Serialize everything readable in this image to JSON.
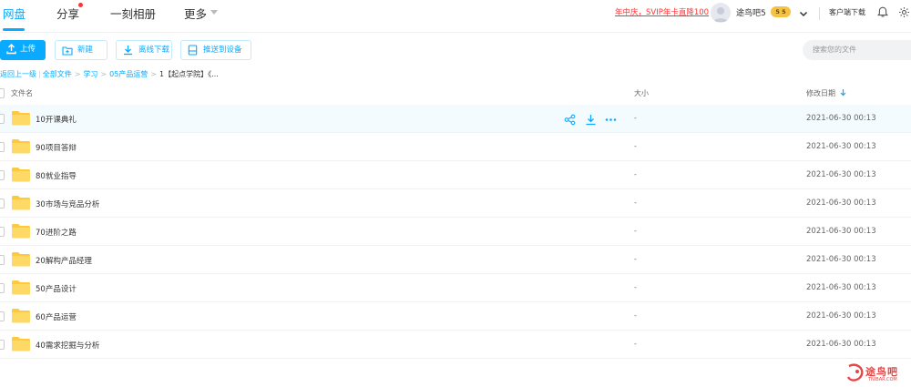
{
  "nav": {
    "tabs": [
      "网盘",
      "分享",
      "一刻相册",
      "更多"
    ],
    "active_tab": "网盘",
    "promo": "年中庆，SVIP年卡直降100",
    "username": "途鸟吧5",
    "vip_badge": "5 5",
    "client_download": "客户端下载"
  },
  "toolbar": {
    "upload": "上传",
    "new": "新建",
    "offline": "离线下载",
    "push": "推送到设备",
    "search_placeholder": "搜索您的文件"
  },
  "breadcrumb": {
    "back": "返回上一级",
    "all": "全部文件",
    "items": [
      "学习",
      "05产品运营"
    ],
    "current": "1【起点学院】《..."
  },
  "table": {
    "headers": {
      "name": "文件名",
      "size": "大小",
      "date": "修改日期"
    },
    "rows": [
      {
        "name": "10开课典礼",
        "size": "-",
        "date": "2021-06-30 00:13"
      },
      {
        "name": "90项目答辩",
        "size": "-",
        "date": "2021-06-30 00:13"
      },
      {
        "name": "80就业指导",
        "size": "-",
        "date": "2021-06-30 00:13"
      },
      {
        "name": "30市场与竞品分析",
        "size": "-",
        "date": "2021-06-30 00:13"
      },
      {
        "name": "70进阶之路",
        "size": "-",
        "date": "2021-06-30 00:13"
      },
      {
        "name": "20解构产品经理",
        "size": "-",
        "date": "2021-06-30 00:13"
      },
      {
        "name": "50产品设计",
        "size": "-",
        "date": "2021-06-30 00:13"
      },
      {
        "name": "60产品运营",
        "size": "-",
        "date": "2021-06-30 00:13"
      },
      {
        "name": "40需求挖掘与分析",
        "size": "-",
        "date": "2021-06-30 00:13"
      }
    ]
  },
  "watermark": {
    "text": "途鸟吧",
    "sub": "TNIBAR.COM"
  },
  "colors": {
    "accent": "#09aaff",
    "promo": "#ff3333",
    "folder": "#ffc93c"
  },
  "icons": [
    "upload-icon",
    "folder-plus-icon",
    "download-icon",
    "device-icon",
    "chevron-down-icon",
    "bell-icon",
    "gear-icon",
    "share-icon",
    "more-icon",
    "sort-down-icon",
    "folder-icon"
  ]
}
